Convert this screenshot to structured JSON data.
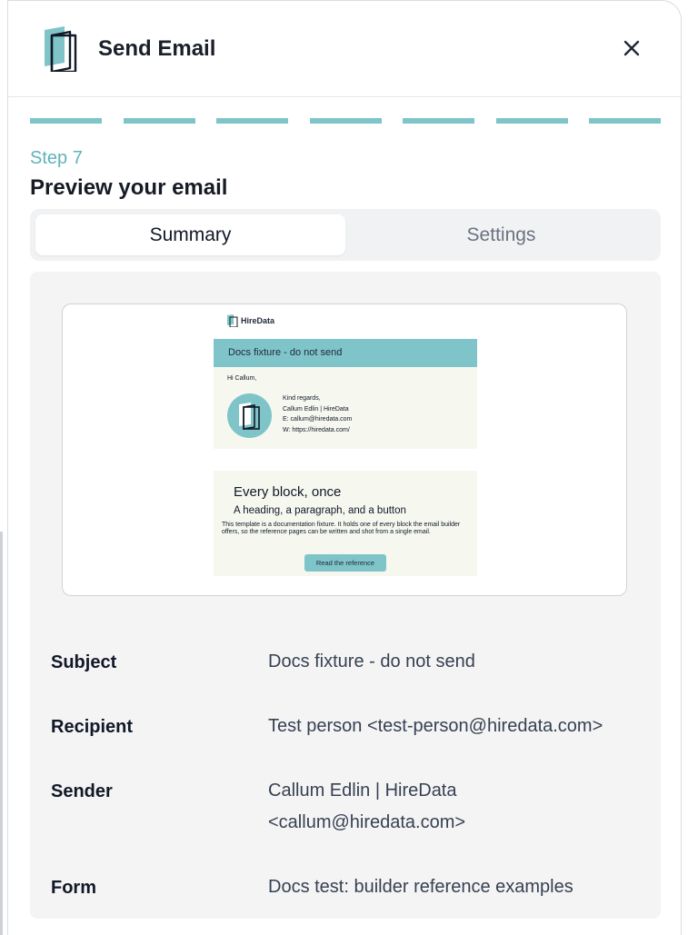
{
  "header": {
    "title": "Send Email",
    "close_icon": "close-icon",
    "logo_icon": "door-logo-icon"
  },
  "progress": {
    "total_steps": 7,
    "completed_steps": 7,
    "color": "#7fc4c9"
  },
  "step": {
    "label": "Step 7",
    "title": "Preview your email"
  },
  "tabs": [
    {
      "label": "Summary",
      "active": true
    },
    {
      "label": "Settings",
      "active": false
    }
  ],
  "preview": {
    "brand": "HireData",
    "subject_banner": "Docs fixture - do not send",
    "greeting": "Hi Callum,",
    "signature": {
      "line1": "Kind regards,",
      "line2": "Callum Edlin | HireData",
      "line3": "E: callum@hiredata.com",
      "line4": "W: https://hiredata.com/"
    },
    "block": {
      "heading": "Every block, once",
      "subheading": "A heading, a paragraph, and a button",
      "paragraph": "This template is a documentation fixture. It holds one of every block the email builder offers, so the reference pages can be written and shot from a single email.",
      "button_label": "Read the reference"
    },
    "accent_color": "#7fc4c9",
    "body_color": "#f6f8f0"
  },
  "summary": {
    "subject_label": "Subject",
    "subject_value": "Docs fixture - do not send",
    "recipient_label": "Recipient",
    "recipient_value": "Test person <test-person@hiredata.com>",
    "sender_label": "Sender",
    "sender_value_line1": "Callum Edlin | HireData",
    "sender_value_line2": "<callum@hiredata.com>",
    "form_label": "Form",
    "form_value": "Docs test: builder reference examples"
  }
}
